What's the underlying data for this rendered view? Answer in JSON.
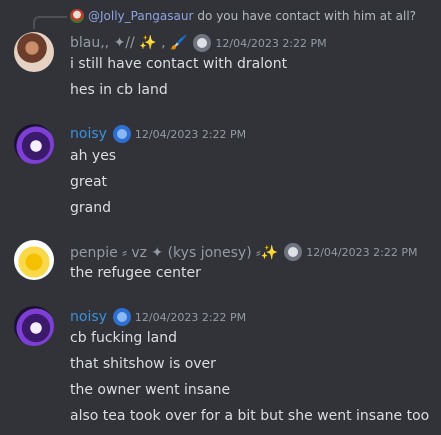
{
  "reply": {
    "author": "@Jolly_Pangasaur",
    "text": "do you have contact with him at all?"
  },
  "messages": [
    {
      "author": "blau,, ✦// ✨ , 🖌️",
      "timestamp": "12/04/2023 2:22 PM",
      "lines": [
        "i still have contact with dralont",
        "hes in cb land"
      ]
    },
    {
      "author": "noisy",
      "timestamp": "12/04/2023 2:22 PM",
      "lines": [
        "ah yes",
        "great",
        "grand"
      ]
    },
    {
      "author": "penpie ⸗ vz ✦ (kys jonesy) ⸗✨",
      "timestamp": "12/04/2023 2:22 PM",
      "lines": [
        "the refugee center"
      ]
    },
    {
      "author": "noisy",
      "timestamp": "12/04/2023 2:22 PM",
      "lines": [
        "cb fucking land",
        "that shitshow is over",
        "the owner went insane",
        "also tea took over for a bit but she went insane too"
      ]
    }
  ],
  "colors": {
    "background": "#313338",
    "text": "#dbdee1",
    "muted": "#949ba4",
    "mention": "#8ea1e1",
    "noisy_name": "#3f8fdb"
  }
}
